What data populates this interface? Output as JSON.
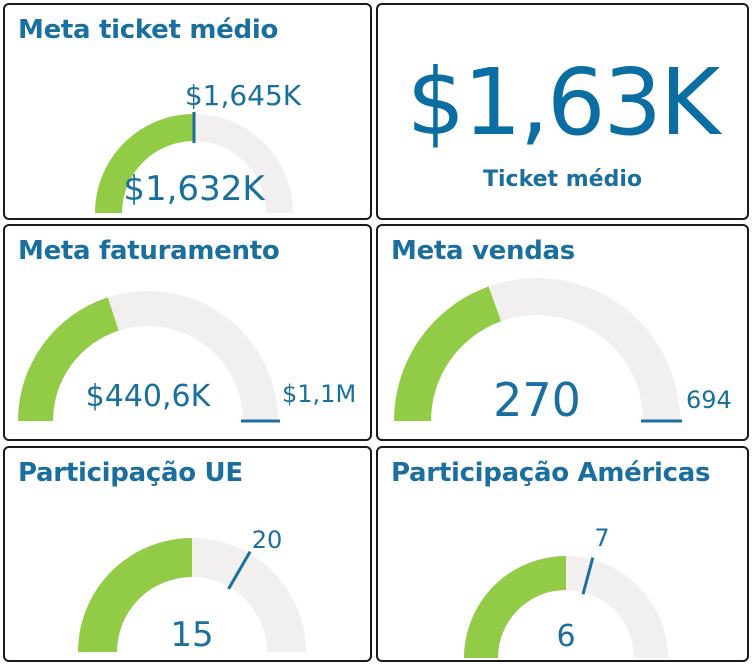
{
  "colors": {
    "accent": "#1a6f9e",
    "fill": "#92cc47",
    "track": "#f1f0ef",
    "target": "#1a6f9e"
  },
  "cards": [
    {
      "id": "meta-ticket-medio",
      "title": "Meta ticket médio",
      "value_label": "$1,632K",
      "target_label": "$1,645K",
      "value_fraction": 0.5,
      "target_fraction": 0.5
    },
    {
      "id": "kpi-ticket-medio",
      "value": "$1,63K",
      "label": "Ticket médio"
    },
    {
      "id": "meta-faturamento",
      "title": "Meta faturamento",
      "value_label": "$440,6K",
      "target_label": "$1,1M",
      "value_fraction": 0.4,
      "target_fraction": 1.0
    },
    {
      "id": "meta-vendas",
      "title": "Meta vendas",
      "value_label": "270",
      "target_label": "694",
      "value_fraction": 0.39,
      "target_fraction": 1.0
    },
    {
      "id": "participacao-ue",
      "title": "Participação UE",
      "value_label": "15",
      "target_label": "20",
      "value_fraction": 0.5,
      "target_fraction": 0.667
    },
    {
      "id": "participacao-americas",
      "title": "Participação Américas",
      "value_label": "6",
      "target_label": "7",
      "value_fraction": 0.5,
      "target_fraction": 0.583
    }
  ]
}
